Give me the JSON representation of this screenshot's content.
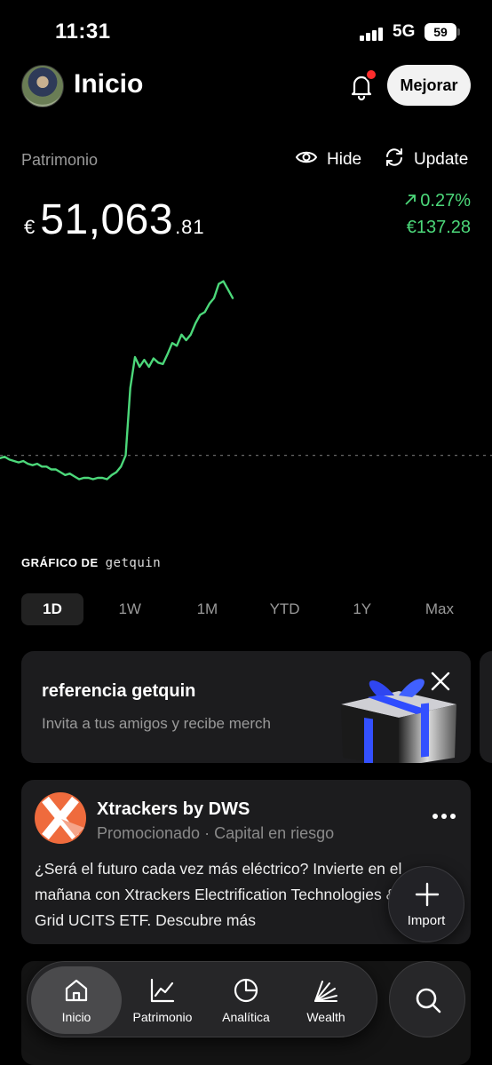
{
  "status_bar": {
    "time": "11:31",
    "network": "5G",
    "battery": "59"
  },
  "header": {
    "title": "Inicio",
    "upgrade_label": "Mejorar",
    "has_notification": true
  },
  "portfolio": {
    "label": "Patrimonio",
    "hide_label": "Hide",
    "update_label": "Update",
    "currency": "€",
    "value_integer": "51,063",
    "value_decimal": ".81",
    "change_percent": "0.27%",
    "change_amount": "€137.28",
    "positive_color": "#4cd87a"
  },
  "chart_data": {
    "type": "line",
    "series": [
      {
        "values": [
          0.28,
          0.29,
          0.27,
          0.26,
          0.25,
          0.26,
          0.24,
          0.23,
          0.24,
          0.22,
          0.22,
          0.2,
          0.2,
          0.18,
          0.16,
          0.17,
          0.15,
          0.13,
          0.14,
          0.14,
          0.13,
          0.14,
          0.14,
          0.13,
          0.16,
          0.18,
          0.22,
          0.3,
          0.78,
          1.0,
          0.93,
          0.98,
          0.93,
          0.99,
          0.96,
          0.95,
          1.02,
          1.1,
          1.08,
          1.16,
          1.12,
          1.16,
          1.24,
          1.3,
          1.32,
          1.38,
          1.42,
          1.52,
          1.54,
          1.48,
          1.42
        ]
      }
    ],
    "baseline": 0,
    "grid": false
  },
  "chart_brand": {
    "prefix": "GRÁFICO DE",
    "name": "getquin"
  },
  "time_ranges": [
    "1D",
    "1W",
    "1M",
    "YTD",
    "1Y",
    "Max"
  ],
  "active_range": "1D",
  "referral_card": {
    "title": "referencia getquin",
    "subtitle": "Invita a tus amigos y recibe merch"
  },
  "ad_card": {
    "name": "Xtrackers by DWS",
    "meta": "Promocionado · Capital en riesgo",
    "body": "¿Será el futuro cada vez más eléctrico? Invierte en el mañana con Xtrackers Electrification Technologies & Smart Grid UCITS ETF. Descubre más"
  },
  "import_button": {
    "label": "Import"
  },
  "bottom_nav": [
    {
      "label": "Inicio",
      "icon": "home-icon",
      "active": true
    },
    {
      "label": "Patrimonio",
      "icon": "chart-line-icon",
      "active": false
    },
    {
      "label": "Analítica",
      "icon": "pie-chart-icon",
      "active": false
    },
    {
      "label": "Wealth",
      "icon": "wealth-rays-icon",
      "active": false
    }
  ]
}
